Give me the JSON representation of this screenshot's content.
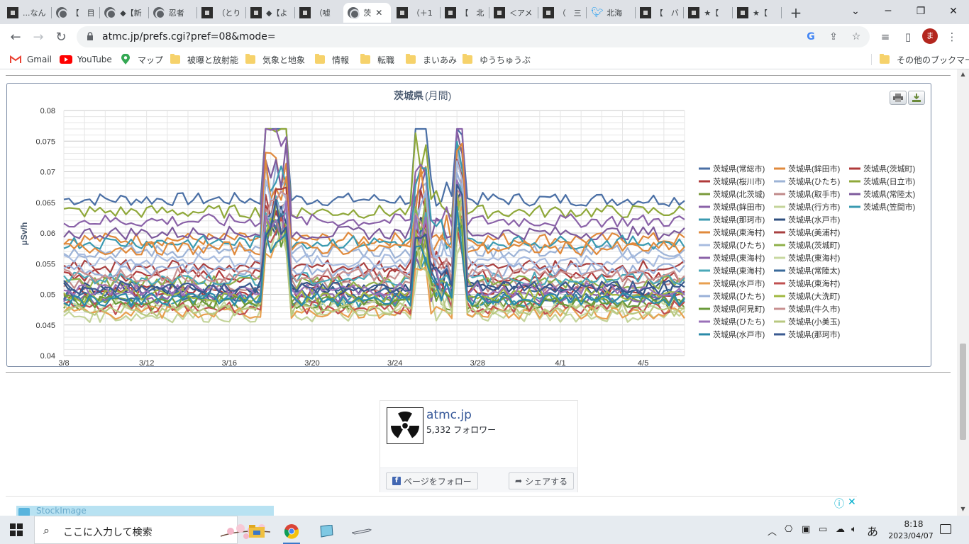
{
  "browser": {
    "tabs": [
      {
        "title": "...なん",
        "icon": "site-icon"
      },
      {
        "title": "【　目",
        "icon": "globe-icon"
      },
      {
        "title": "◆【新",
        "icon": "globe-icon"
      },
      {
        "title": "忍者",
        "icon": "globe-icon"
      },
      {
        "title": "（とり",
        "icon": "site-icon"
      },
      {
        "title": "◆【よ",
        "icon": "site-icon"
      },
      {
        "title": "（嘘",
        "icon": "site-icon"
      },
      {
        "title": "茨",
        "icon": "globe-icon",
        "active": true
      },
      {
        "title": "（＋1",
        "icon": "site-icon"
      },
      {
        "title": "【　北",
        "icon": "site-icon"
      },
      {
        "title": "＜アメ",
        "icon": "site-icon"
      },
      {
        "title": "（　三",
        "icon": "site-icon"
      },
      {
        "title": "北海",
        "icon": "twitter-bird-icon"
      },
      {
        "title": "【　バ",
        "icon": "site-icon"
      },
      {
        "title": "★【",
        "icon": "site-icon"
      },
      {
        "title": "★【",
        "icon": "site-icon"
      }
    ],
    "new_tab": "+",
    "url": "atmc.jp/prefs.cgi?pref=08&mode=",
    "profile_initial": "ま",
    "bookmarks": [
      {
        "label": "Gmail",
        "icon": "gmail-icon"
      },
      {
        "label": "YouTube",
        "icon": "youtube-icon"
      },
      {
        "label": "マップ",
        "icon": "maps-pin-icon"
      },
      {
        "label": "被曝と放射能",
        "icon": "folder-icon"
      },
      {
        "label": "気象と地象",
        "icon": "folder-icon"
      },
      {
        "label": "情報",
        "icon": "folder-icon"
      },
      {
        "label": "転職",
        "icon": "folder-icon"
      },
      {
        "label": "まいあみ",
        "icon": "folder-icon"
      },
      {
        "label": "ゆうちゅうぶ",
        "icon": "folder-icon"
      }
    ],
    "other_bookmarks": "その他のブックマーク"
  },
  "chart_data": {
    "type": "line",
    "title": "茨城県",
    "subtitle": "(月間)",
    "ylabel": "μSv/h",
    "xlabel": "",
    "ylim": [
      0.04,
      0.08
    ],
    "yticks": [
      "0.04",
      "0.045",
      "0.05",
      "0.055",
      "0.06",
      "0.065",
      "0.07",
      "0.075",
      "0.08"
    ],
    "xticks": [
      "3/8",
      "3/12",
      "3/16",
      "3/20",
      "3/24",
      "3/28",
      "4/1",
      "4/5"
    ],
    "x_start": "3/8",
    "x_end": "4/6",
    "grid": true,
    "legend_position": "right",
    "legend": [
      "茨城県(常総市)",
      "茨城県(鉾田市)",
      "茨城県(茨城町)",
      "茨城県(桜川市)",
      "茨城県(ひたち)",
      "茨城県(日立市)",
      "茨城県(北茨城)",
      "茨城県(取手市)",
      "茨城県(常陸太)",
      "茨城県(鉾田市)",
      "茨城県(行方市)",
      "茨城県(笠間市)",
      "茨城県(那珂市)",
      "茨城県(水戸市)",
      "茨城県(東海村)",
      "茨城県(美浦村)",
      "茨城県(ひたち)",
      "茨城県(茨城町)",
      "茨城県(東海村)",
      "茨城県(東海村)",
      "茨城県(東海村)",
      "茨城県(常陸太)",
      "茨城県(水戸市)",
      "茨城県(東海村)",
      "茨城県(ひたち)",
      "茨城県(大洗町)",
      "茨城県(阿見町)",
      "茨城県(牛久市)",
      "茨城県(ひたち)",
      "茨城県(小美玉)",
      "茨城県(水戸市)",
      "茨城県(那珂市)"
    ],
    "series": [
      {
        "color": "#4a6fa5",
        "base": 0.0655
      },
      {
        "color": "#e08a3c",
        "base": 0.059
      },
      {
        "color": "#b03a3a",
        "base": 0.053
      },
      {
        "color": "#b03a3a",
        "base": 0.0505
      },
      {
        "color": "#9db3d6",
        "base": 0.057
      },
      {
        "color": "#8fa83a",
        "base": 0.0635
      },
      {
        "color": "#7a9a3a",
        "base": 0.0485
      },
      {
        "color": "#c08a8a",
        "base": 0.0515
      },
      {
        "color": "#7d5a9c",
        "base": 0.06
      },
      {
        "color": "#8a62a8",
        "base": 0.062
      },
      {
        "color": "#c4d49a",
        "base": 0.0465
      },
      {
        "color": "#3a9ab0",
        "base": 0.049
      },
      {
        "color": "#3a9ab0",
        "base": 0.0585
      },
      {
        "color": "#2f4f7f",
        "base": 0.051
      },
      {
        "color": "#e08a3c",
        "base": 0.0575
      },
      {
        "color": "#a84040",
        "base": 0.0545
      },
      {
        "color": "#a8bce0",
        "base": 0.0555
      },
      {
        "color": "#8fb04a",
        "base": 0.052
      },
      {
        "color": "#8a62a8",
        "base": 0.0495
      },
      {
        "color": "#c8d8a0",
        "base": 0.048
      },
      {
        "color": "#4aa8b8",
        "base": 0.0525
      },
      {
        "color": "#3a6a9a",
        "base": 0.05
      },
      {
        "color": "#e8a050",
        "base": 0.047
      },
      {
        "color": "#c05050",
        "base": 0.0478
      },
      {
        "color": "#9ab0d8",
        "base": 0.054
      },
      {
        "color": "#a0b840",
        "base": 0.0498
      },
      {
        "color": "#6a9a3a",
        "base": 0.0488
      },
      {
        "color": "#c89090",
        "base": 0.0532
      },
      {
        "color": "#9a70b8",
        "base": 0.0508
      },
      {
        "color": "#b8c880",
        "base": 0.0475
      },
      {
        "color": "#2a8aa8",
        "base": 0.0492
      },
      {
        "color": "#3a5a90",
        "base": 0.0512
      }
    ]
  },
  "export_buttons": {
    "print_icon": "printer-icon",
    "download_icon": "download-icon"
  },
  "facebook": {
    "name": "atmc.jp",
    "followers": "5,332 フォロワー",
    "follow_label": "ページをフォロー",
    "share_label": "シェアする",
    "logo_icon": "radiation-trefoil-icon"
  },
  "ad": {
    "text": "StockImage"
  },
  "taskbar": {
    "search_placeholder": "ここに入力して検索",
    "ime_label": "あ",
    "time": "8:18",
    "date": "2023/04/07"
  }
}
